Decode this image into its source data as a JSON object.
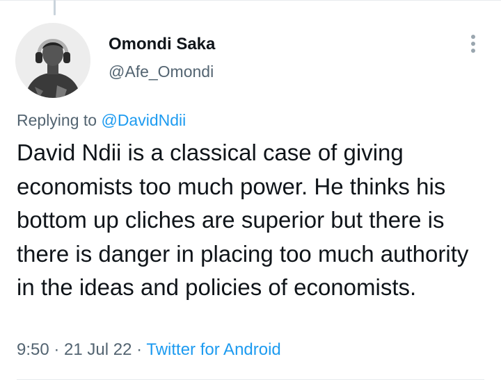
{
  "tweet": {
    "author": {
      "name": "Omondi Saka",
      "handle": "@Afe_Omondi",
      "avatar_icon": "profile-photo"
    },
    "replying_prefix": "Replying to ",
    "replying_to": "@DavidNdii",
    "text": "David Ndii is a classical case of giving economists too much power. He thinks his bottom up cliches are superior but there is there is danger in placing too much authority in the ideas and policies of economists.",
    "time": "9:50",
    "separator": " · ",
    "date": "21 Jul 22",
    "source": "Twitter for Android",
    "more_icon": "more-vertical-icon"
  },
  "colors": {
    "text_primary": "#0f1419",
    "text_secondary": "#536471",
    "link": "#1d9bf0",
    "divider": "#e7ebee"
  }
}
